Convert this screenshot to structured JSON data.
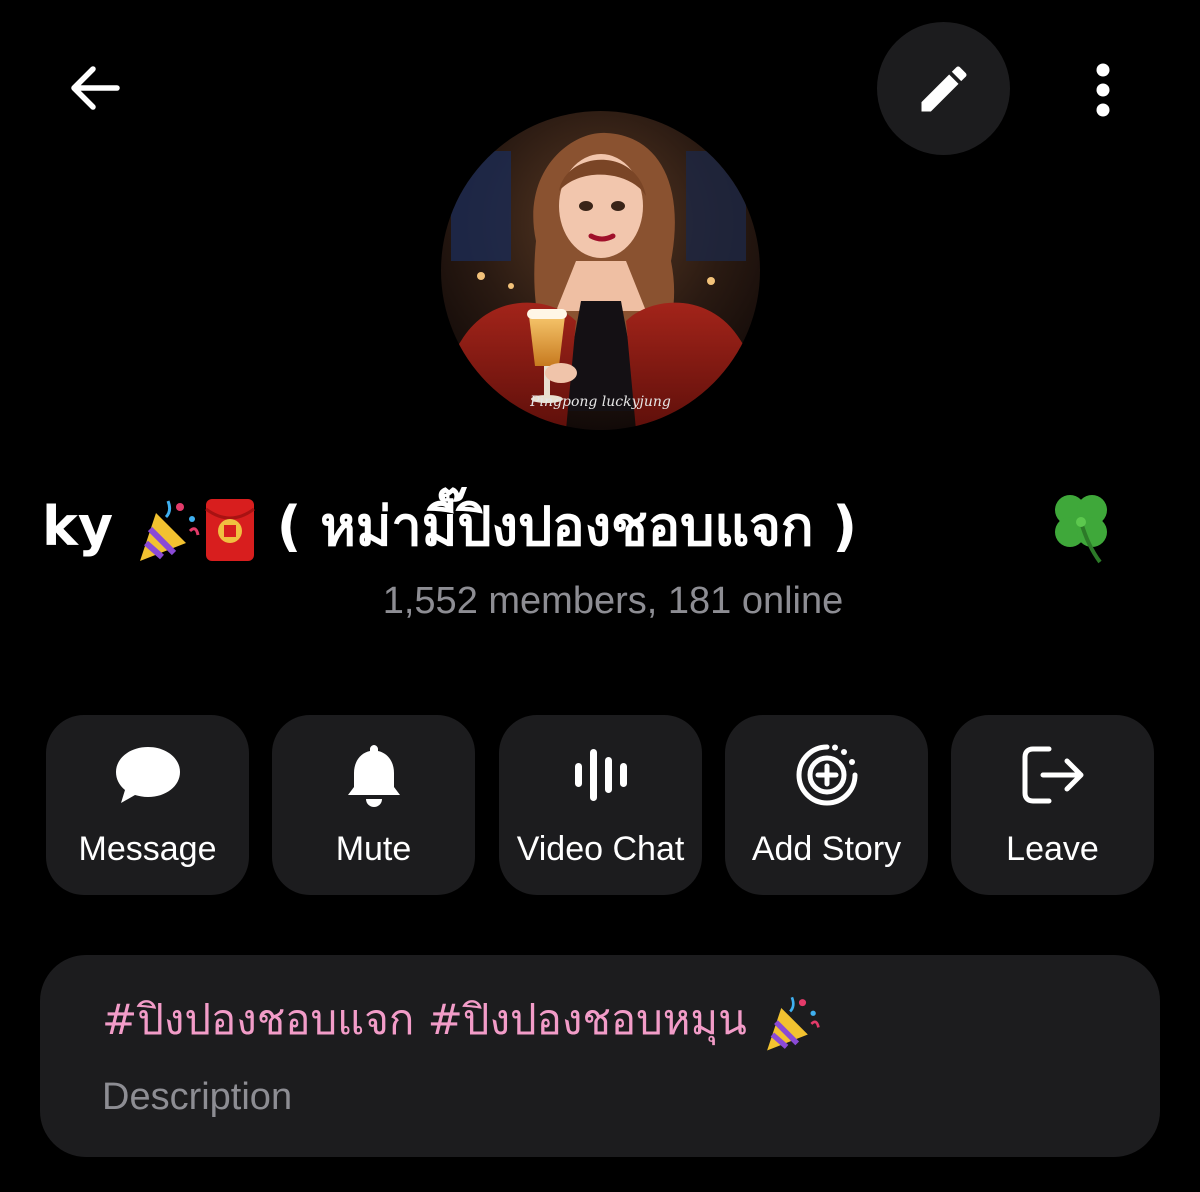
{
  "header": {
    "back_icon": "arrow-left-icon",
    "edit_icon": "pencil-icon",
    "more_icon": "more-vertical-icon"
  },
  "profile": {
    "avatar_caption": "Pingpong luckyjung",
    "title_prefix": "ky",
    "title_main": "( หม่ามี๊ปิงปองชอบแจก )",
    "title_emojis": [
      "party-popper-emoji",
      "red-envelope-emoji",
      "four-leaf-clover-emoji"
    ],
    "members_text": "1,552 members, 181 online"
  },
  "actions": [
    {
      "label": "Message",
      "icon": "chat-bubble-icon"
    },
    {
      "label": "Mute",
      "icon": "bell-icon"
    },
    {
      "label": "Video Chat",
      "icon": "voice-chat-icon"
    },
    {
      "label": "Add Story",
      "icon": "add-story-icon"
    },
    {
      "label": "Leave",
      "icon": "leave-icon"
    }
  ],
  "description": {
    "text": "#ปิงปองชอบแจก #ปิงปองชอบหมุน",
    "label": "Description"
  },
  "colors": {
    "background": "#000000",
    "card": "#1c1c1e",
    "secondary_text": "#8d8d93",
    "hashtag": "#f29cc8"
  }
}
